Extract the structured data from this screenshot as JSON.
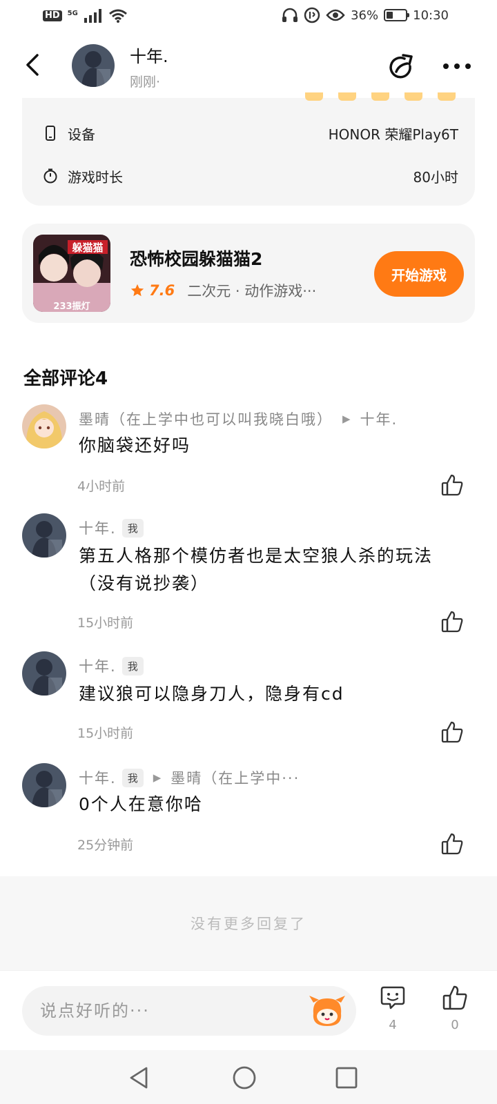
{
  "status_bar": {
    "hd": "HD",
    "network": "5G",
    "battery_text": "36%",
    "battery_level": 0.36,
    "time": "10:30",
    "left_icons": [
      "hd-icon",
      "signal-icon",
      "wifi-icon"
    ],
    "right_icons": [
      "headphones-icon",
      "data-saver-icon",
      "eye-icon",
      "battery-icon"
    ]
  },
  "header": {
    "author": "十年.",
    "time": "刚刚·"
  },
  "device_info": {
    "device_label": "设备",
    "device_value": "HONOR 荣耀Play6T",
    "playtime_label": "游戏时长",
    "playtime_value": "80小时"
  },
  "game": {
    "title": "恐怖校园躲猫猫2",
    "rating": "7.6",
    "tags": "二次元 · 动作游戏···",
    "start_label": "开始游戏",
    "thumb_text_top": "躲猫猫",
    "thumb_text_bottom": "233振灯"
  },
  "comments": {
    "title": "全部评论4",
    "me_badge": "我",
    "items": [
      {
        "author": "墨晴（在上学中也可以叫我晓白哦）",
        "reply_to": "十年.",
        "text": "你脑袋还好吗",
        "time": "4小时前"
      },
      {
        "author": "十年.",
        "text": "第五人格那个模仿者也是太空狼人杀的玩法（没有说抄袭）",
        "time": "15小时前"
      },
      {
        "author": "十年.",
        "text": "建议狼可以隐身刀人，隐身有cd",
        "time": "15小时前"
      },
      {
        "author": "十年.",
        "reply_to": "墨晴（在上学中···",
        "text": "0个人在意你哈",
        "time": "25分钟前"
      }
    ]
  },
  "footer": {
    "no_more": "没有更多回复了",
    "input_placeholder": "说点好听的···",
    "comment_count": "4",
    "like_count": "0"
  },
  "colors": {
    "accent": "#ff7a14",
    "card_bg": "#f5f5f5",
    "muted_text": "#999999"
  }
}
